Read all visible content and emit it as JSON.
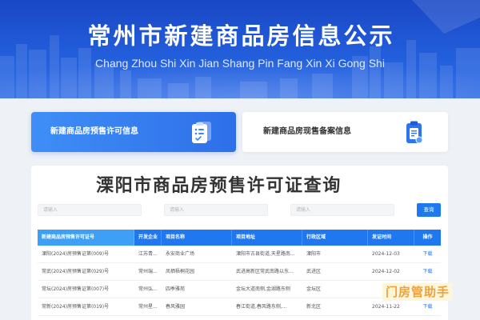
{
  "header": {
    "title": "常州市新建商品房信息公示",
    "subtitle": "Chang Zhou Shi Xin Jian Shang Pin Fang Xin Xi Gong Shi"
  },
  "nav_cards": [
    {
      "label": "新建商品房预售许可信息",
      "icon": "clipboard-check-icon",
      "active": true
    },
    {
      "label": "新建商品房现售备案信息",
      "icon": "document-clipboard-icon",
      "active": false
    }
  ],
  "query": {
    "title": "溧阳市商品房预售许可证查询",
    "filters": [
      {
        "placeholder": "请输入"
      },
      {
        "placeholder": "请输入"
      },
      {
        "placeholder": "请输入"
      }
    ],
    "search_label": "查询"
  },
  "table": {
    "columns": [
      "新建商品房预售许可证号",
      "开发企业",
      "项目名称",
      "项目地址",
      "行政区域",
      "发证时间",
      "操作"
    ],
    "rows": [
      {
        "permit_no": "溧阳(2024)房预售证第(009)号",
        "developer": "江苏青...",
        "project": "永安商业广场",
        "address": "溧阳市古县街道,天星路南...",
        "district": "溧阳市",
        "issue_date": "2024-12-03",
        "action": "下载"
      },
      {
        "permit_no": "常武(2024)房预售证第(029)号",
        "developer": "常州瑞...",
        "project": "凤栖梧桐花园",
        "address": "武进高新区常武南路以东...",
        "district": "武进区",
        "issue_date": "2024-12-02",
        "action": "下载"
      },
      {
        "permit_no": "常坛(2024)房预售证第(007)号",
        "developer": "常州弘...",
        "project": "四季雅苑",
        "address": "金坛大道南侧,金湖路东侧",
        "district": "金坛区"
      },
      {
        "permit_no": "常新(2024)房预售证第(019)号",
        "developer": "常州星...",
        "project": "春风雅园",
        "address": "春江街道,春风路东侧,...",
        "district": "新北区",
        "issue_date": "2024-11-22",
        "action": "下载"
      }
    ]
  },
  "watermark": "门房管助手",
  "colors": {
    "banner_blue": "#2360dd",
    "primary": "#1f78ee",
    "table_header": "#1f78ef",
    "table_header_first": "#3d9ff6",
    "page_bg": "#eef1f6",
    "watermark_text": "#eea13a"
  }
}
